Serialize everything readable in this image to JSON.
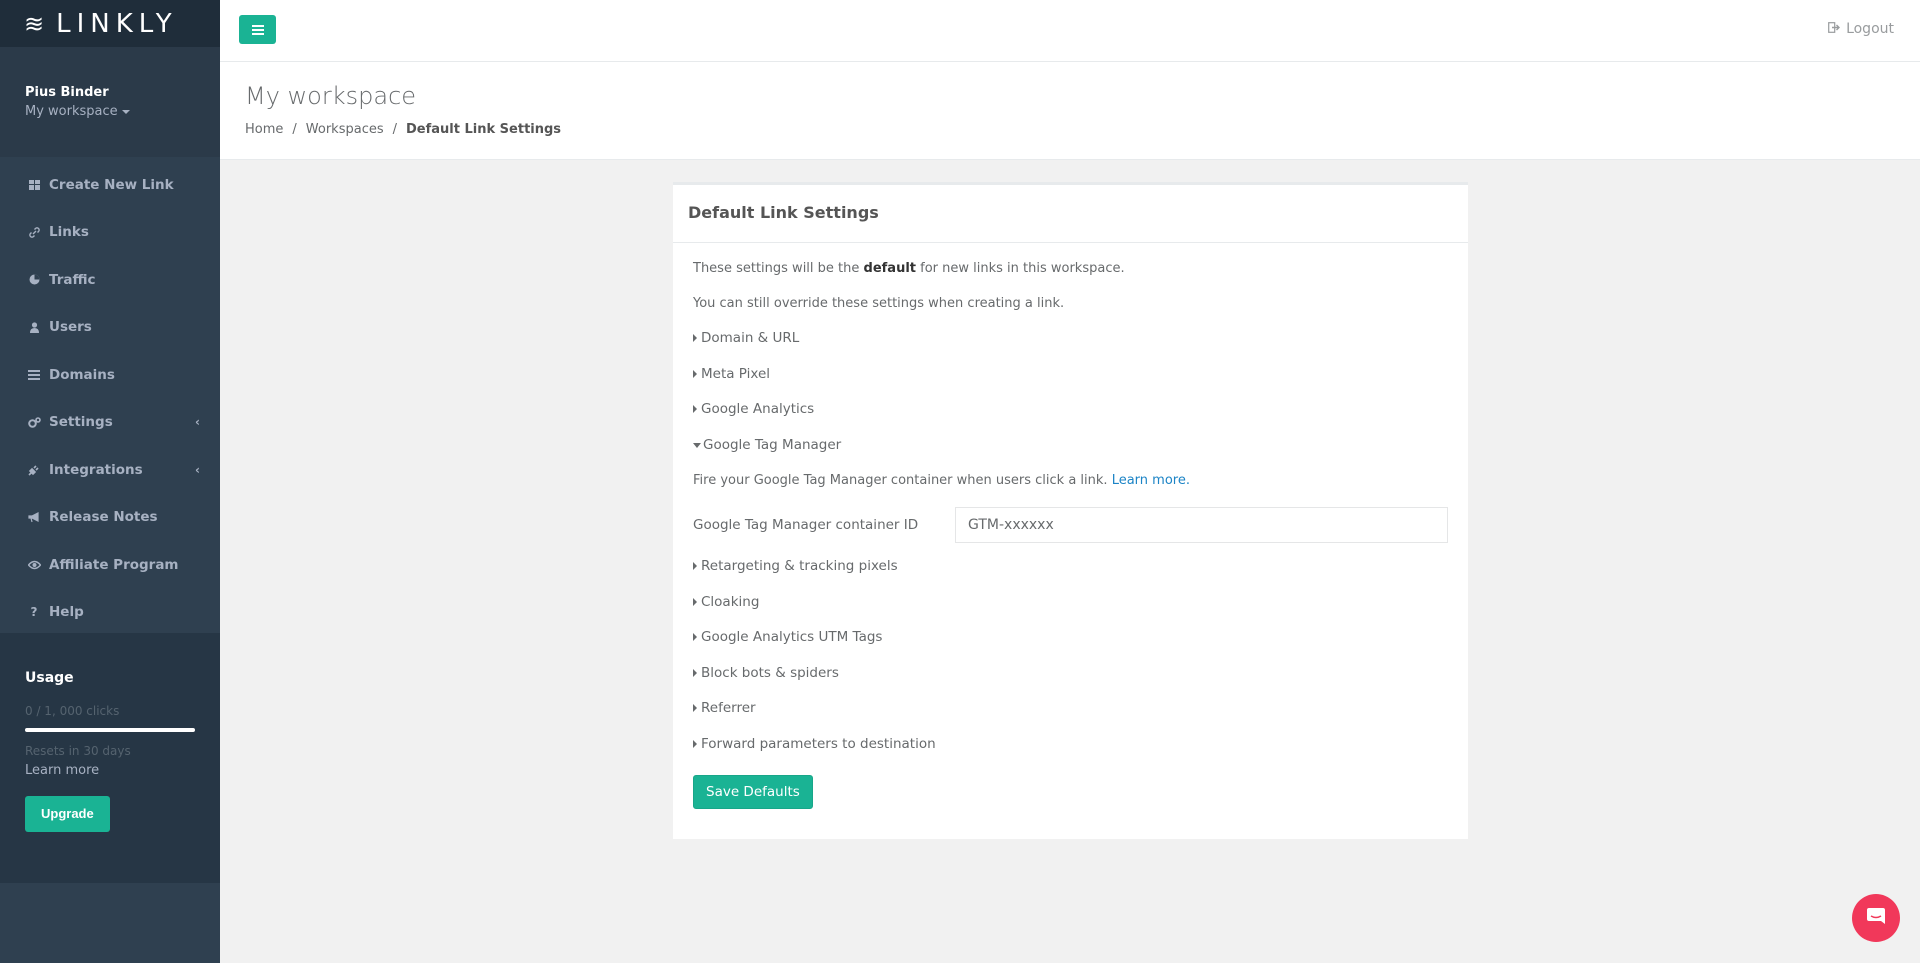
{
  "brand": {
    "logo_text": "LINKLY",
    "logo_mark": "≋"
  },
  "profile": {
    "name": "Pius Binder",
    "workspace": "My workspace"
  },
  "nav": {
    "items": [
      {
        "label": "Create New Link",
        "icon": "grid-icon"
      },
      {
        "label": "Links",
        "icon": "link-icon"
      },
      {
        "label": "Traffic",
        "icon": "pie-chart-icon"
      },
      {
        "label": "Users",
        "icon": "user-icon"
      },
      {
        "label": "Domains",
        "icon": "list-icon"
      },
      {
        "label": "Settings",
        "icon": "gears-icon"
      },
      {
        "label": "Integrations",
        "icon": "plug-icon"
      },
      {
        "label": "Release Notes",
        "icon": "megaphone-icon"
      },
      {
        "label": "Affiliate Program",
        "icon": "eye-icon"
      },
      {
        "label": "Help",
        "icon": "question-icon"
      }
    ]
  },
  "usage": {
    "title": "Usage",
    "clicks": "0 / 1, 000 clicks",
    "fraction": 0.0,
    "resets": "Resets in 30 days",
    "learn_more": "Learn more",
    "upgrade": "Upgrade"
  },
  "topbar": {
    "logout": "Logout"
  },
  "heading": {
    "title": "My workspace",
    "breadcrumb": [
      "Home",
      "Workspaces",
      "Default Link Settings"
    ]
  },
  "card": {
    "title": "Default Link Settings",
    "intro_pre": "These settings will be the ",
    "intro_bold": "default",
    "intro_post": " for new links in this workspace.",
    "override": "You can still override these settings when creating a link.",
    "sections_before": [
      "Domain & URL",
      "Meta Pixel",
      "Google Analytics"
    ],
    "open_section": "Google Tag Manager",
    "gtm_desc": "Fire your Google Tag Manager container when users click a link. ",
    "gtm_learn": "Learn more.",
    "gtm_label": "Google Tag Manager container ID",
    "gtm_placeholder": "GTM-xxxxxx",
    "sections_after": [
      "Retargeting & tracking pixels",
      "Cloaking",
      "Google Analytics UTM Tags",
      "Block bots & spiders",
      "Referrer",
      "Forward parameters to destination"
    ],
    "save": "Save Defaults"
  },
  "colors": {
    "accent": "#1ab394",
    "sidebar": "#2f4050",
    "chat": "#f1385a"
  }
}
